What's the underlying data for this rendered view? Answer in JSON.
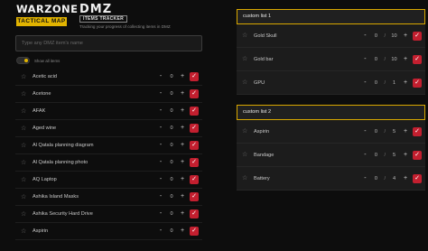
{
  "header": {
    "logo_title": "WARZONE",
    "logo_subtitle": "TACTICAL MAP",
    "dmz_logo": "DMZ",
    "dmz_tag": "ITEMS TRACKER",
    "description": "Tracking your progress of collecting items in DMZ"
  },
  "search": {
    "placeholder": "Type any DMZ item's name"
  },
  "toggle": {
    "label": "Show all items",
    "on": true
  },
  "items": [
    {
      "name": "Acetic acid",
      "qty": "0"
    },
    {
      "name": "Acetone",
      "qty": "0"
    },
    {
      "name": "AFAK",
      "qty": "0"
    },
    {
      "name": "Aged wine",
      "qty": "0"
    },
    {
      "name": "Al Qatala planning diagram",
      "qty": "0"
    },
    {
      "name": "Al Qatala planning photo",
      "qty": "0"
    },
    {
      "name": "AQ Laptop",
      "qty": "0"
    },
    {
      "name": "Ashika Island Masks",
      "qty": "0"
    },
    {
      "name": "Ashika Security Hard Drive",
      "qty": "0"
    },
    {
      "name": "Aspirin",
      "qty": "0"
    }
  ],
  "custom_lists": [
    {
      "title": "custom list 1",
      "items": [
        {
          "name": "Gold Skull",
          "qty": "0",
          "max": "10"
        },
        {
          "name": "Gold bar",
          "qty": "0",
          "max": "10"
        },
        {
          "name": "GPU",
          "qty": "0",
          "max": "1"
        }
      ]
    },
    {
      "title": "custom list 2",
      "items": [
        {
          "name": "Aspirin",
          "qty": "0",
          "max": "5"
        },
        {
          "name": "Bandage",
          "qty": "0",
          "max": "5"
        },
        {
          "name": "Battery",
          "qty": "0",
          "max": "4"
        }
      ]
    }
  ],
  "icons": {
    "favorite": "star-icon",
    "decrement": "minus-icon",
    "increment": "plus-icon",
    "done": "check-icon"
  },
  "colors": {
    "accent": "#e2b400",
    "check": "#c31f2f",
    "background": "#0d0d0d"
  },
  "symbols": {
    "minus": "-",
    "plus": "+",
    "slash": "/",
    "check": "✓",
    "star": "☆"
  }
}
